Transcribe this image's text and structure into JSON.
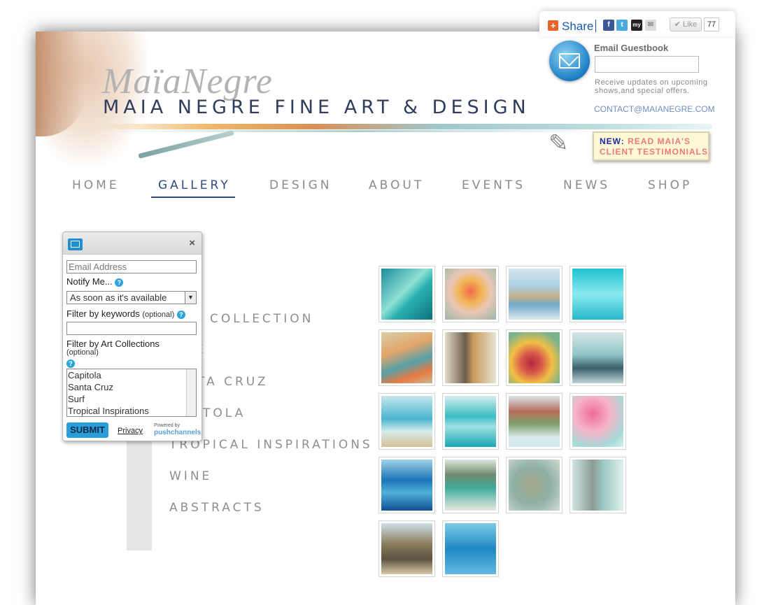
{
  "share": {
    "label": "Share",
    "icons": [
      "facebook-icon",
      "twitter-icon",
      "myspace-icon",
      "email-icon"
    ],
    "like_label": "Like",
    "like_count": "77"
  },
  "header": {
    "signature": "MaïaNegre",
    "title": "MAIA NEGRE FINE ART & DESIGN"
  },
  "guestbook": {
    "title": "Email Guestbook",
    "note": "Receive updates on upcoming shows,and special offers.",
    "contact": "CONTACT@MAIANEGRE.COM"
  },
  "testimonials": {
    "new_label": "NEW:",
    "line1": "READ MAIA'S",
    "line2": "CLIENT TESTIMONIALS"
  },
  "nav": {
    "items": [
      "HOME",
      "GALLERY",
      "DESIGN",
      "ABOUT",
      "EVENTS",
      "NEWS",
      "SHOP"
    ],
    "active": "GALLERY"
  },
  "collections": [
    "COLLECTION",
    "E",
    "TA CRUZ",
    "ITOLA",
    "TROPICAL INSPIRATIONS",
    "WINE",
    "ABSTRACTS"
  ],
  "widget": {
    "email_placeholder": "Email Address",
    "notify_label": "Notify Me...",
    "notify_value": "As soon as it's available",
    "keywords_label": "Filter by keywords",
    "optional": "(optional)",
    "collections_label": "Filter by Art Collections",
    "collections_options": [
      "Capitola",
      "Santa Cruz",
      "Surf",
      "Tropical Inspirations"
    ],
    "submit": "SUBMIT",
    "privacy": "Privacy",
    "powered": "Powered by",
    "powered_brand": "pushchannels",
    "help": "?",
    "close": "×"
  },
  "colors": {
    "nav_active": "#2d4b7c",
    "nav": "#8b8b8b",
    "contact": "#6f8fbf",
    "widget_button": "#2a9ed8"
  }
}
